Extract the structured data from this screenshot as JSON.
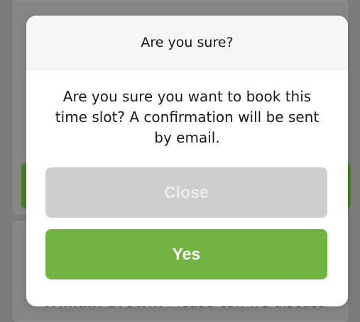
{
  "background": {
    "partial_text_name": "William Brown:",
    "partial_text_rest": " Please can we discuss"
  },
  "dialog": {
    "title": "Are you sure?",
    "message": "Are you sure you want to book this time slot? A confirmation will be sent by email.",
    "close_label": "Close",
    "yes_label": "Yes"
  },
  "colors": {
    "accent_green": "#72b441",
    "close_gray": "#cfcfcf"
  }
}
